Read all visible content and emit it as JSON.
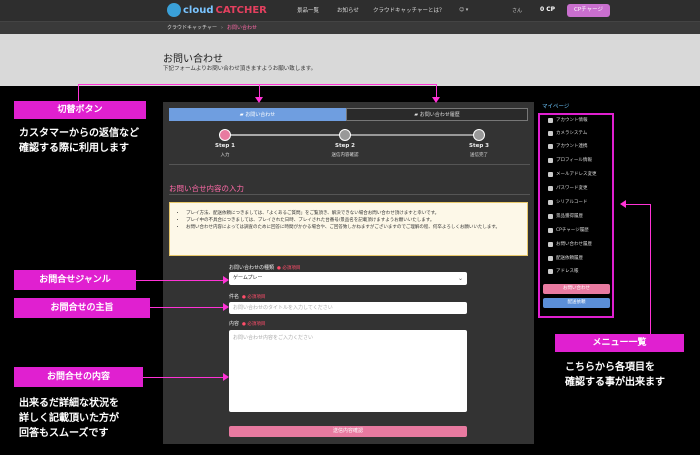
{
  "header": {
    "logo_a": "cloud",
    "logo_b": "CATCHER",
    "nav": [
      "景品一覧",
      "お知らせ",
      "クラウドキャッチャーとは？"
    ],
    "user": "さん",
    "cp": "0 CP",
    "charge": "CPチャージ"
  },
  "breadcrumb": {
    "home": "クラウドキャッチャー",
    "current": "お問い合わせ"
  },
  "page": {
    "title": "お問い合わせ",
    "subtitle": "下記フォームよりお問い合わせ頂きますようお願い致します。"
  },
  "tabs": {
    "inquiry": "お問い合わせ",
    "history": "お問い合わせ履歴"
  },
  "steps": [
    {
      "label": "Step 1",
      "sub": "入力"
    },
    {
      "label": "Step 2",
      "sub": "送信内容確認"
    },
    {
      "label": "Step 3",
      "sub": "送信完了"
    }
  ],
  "form": {
    "section_title": "お問い合せ内容の入力",
    "notices": [
      "プレイ方法、配送依頼につきましては、「よくあるご質問」をご覧頂き、解決できない場合お問い合わせ頂けますと幸いです。",
      "プレイ中の不具合につきましては、プレイされた日時、プレイされた台番号/景品名を記載頂けますようお願いいたします。",
      "お問い合わせ内容によっては調査のために回答に時間がかかる場合や、ご回答致しかねますがございますのでご理解の程、何卒よろしくお願いいたします。"
    ],
    "genre_label": "お問い合わせの種類",
    "required": "必須項目",
    "genre_value": "ゲームプレー",
    "subject_label": "件名",
    "subject_placeholder": "お問い合わせのタイトルを入力してください",
    "body_label": "内容",
    "body_placeholder": "お問い合わせ内容をご入力ください",
    "submit": "送信内容確認"
  },
  "sidebar": {
    "title": "マイページ",
    "items": [
      "アカウント情報",
      "カメラシステム",
      "アカウント連携",
      "プロフィール情報",
      "メールアドレス変更",
      "パスワード変更",
      "シリアルコード",
      "景品獲得履歴",
      "CPチャージ履歴",
      "お問い合わせ履歴",
      "配送依頼履歴",
      "アドレス帳"
    ],
    "btn_inquiry": "お問い合わせ",
    "btn_delivery": "配送依頼"
  },
  "annotations": {
    "switch_button": "切替ボタン",
    "switch_desc_1": "カスタマーからの返信など",
    "switch_desc_2": "確認する際に利用します",
    "genre": "お問合せジャンル",
    "subject": "お問合せの主旨",
    "content": "お問合せの内容",
    "content_desc_1": "出来るだ詳細な状況を",
    "content_desc_2": "詳しく記載頂いた方が",
    "content_desc_3": "回答もスムーズです",
    "menu": "メニュー一覧",
    "menu_desc_1": "こちらから各項目を",
    "menu_desc_2": "確認する事が出来ます"
  },
  "colors": {
    "accent": "#e020d0",
    "pink": "#e87aa0",
    "tab_active": "#6f9ee0"
  }
}
